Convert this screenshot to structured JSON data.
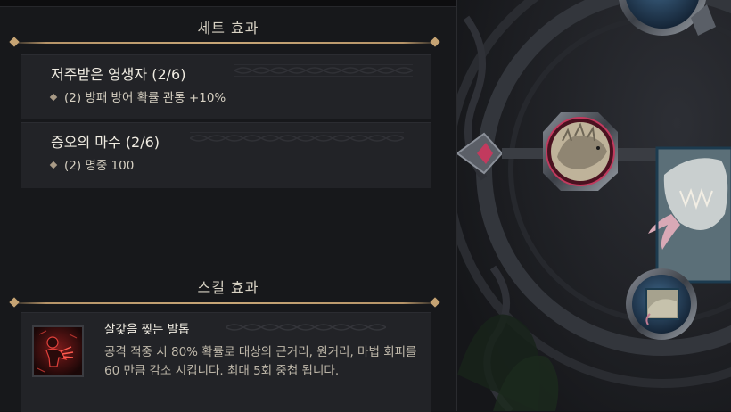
{
  "set_effects": {
    "title": "세트 효과",
    "items": [
      {
        "name": "저주받은 영생자 (2/6)",
        "effect": "(2) 방패 방어 확률 관통 +10%"
      },
      {
        "name": "증오의 마수 (2/6)",
        "effect": "(2) 명중 100"
      }
    ]
  },
  "skill_effects": {
    "title": "스킬 효과",
    "skill": {
      "name": "살갗을 찢는 발톱",
      "icon": "clawing-creature-icon",
      "description": "공격 적중 시 80% 확률로 대상의 근거리, 원거리, 마법 회피를 60 만큼 감소 시킵니다. 최대 5회 중첩 됩니다."
    }
  },
  "colors": {
    "accent_gold": "#c6a373",
    "panel_bg": "#17181b",
    "card_bg": "#222327",
    "text_main": "#f0ece2",
    "text_muted": "#bfb8aa",
    "gem_pink": "#c23a5e",
    "orb_blue": "#2c4a68"
  },
  "equipment_slot": {
    "icon": "lizard-beast-icon",
    "state": "equipped"
  }
}
